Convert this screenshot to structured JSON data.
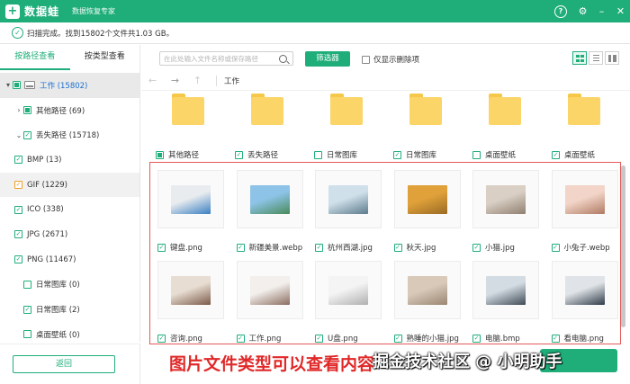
{
  "app": {
    "brand": "数据蛙",
    "subtitle": "数据恢复专家"
  },
  "window_controls": {
    "help": "?",
    "settings": "⚙",
    "minimize": "–",
    "close": "✕"
  },
  "status": {
    "text": "扫描完成。找到15802个文件共1.03 GB。"
  },
  "sidebar": {
    "tabs": [
      {
        "label": "按路径查看",
        "active": true
      },
      {
        "label": "按类型查看",
        "active": false
      }
    ],
    "tree": [
      {
        "label": "工作 (15802)",
        "level": 0,
        "arrow": "▾",
        "check": "partial",
        "drive": true
      },
      {
        "label": "其他路径 (69)",
        "level": 1,
        "arrow": "›",
        "check": "partial"
      },
      {
        "label": "丢失路径 (15718)",
        "level": 1,
        "arrow": "⌄",
        "check": "checked"
      },
      {
        "label": "BMP (13)",
        "level": 2,
        "check": "checked"
      },
      {
        "label": "GIF (1229)",
        "level": 2,
        "check": "checked",
        "highlight": true
      },
      {
        "label": "ICO (338)",
        "level": 2,
        "check": "checked"
      },
      {
        "label": "JPG (2671)",
        "level": 2,
        "check": "checked"
      },
      {
        "label": "PNG (11467)",
        "level": 2,
        "check": "checked"
      },
      {
        "label": "日常图库 (0)",
        "level": 1,
        "check": "empty"
      },
      {
        "label": "日常图库 (2)",
        "level": 1,
        "check": "checked"
      },
      {
        "label": "桌面壁纸 (0)",
        "level": 1,
        "check": "empty"
      }
    ],
    "back_label": "返回"
  },
  "toolbar": {
    "search_placeholder": "在此处输入文件名称或保存路径",
    "filter_label": "筛选器",
    "only_deleted_label": "仅显示删除项"
  },
  "path": {
    "back": "←",
    "forward": "→",
    "up": "↑",
    "current": "工作"
  },
  "folders": [
    {
      "label": "其他路径",
      "check": "partial"
    },
    {
      "label": "丢失路径",
      "check": "checked"
    },
    {
      "label": "日常图库",
      "check": "empty"
    },
    {
      "label": "日常图库",
      "check": "checked"
    },
    {
      "label": "桌面壁纸",
      "check": "empty"
    },
    {
      "label": "桌面壁纸",
      "check": "checked"
    }
  ],
  "images": [
    {
      "label": "键盘.png",
      "icon": "keyboard-image",
      "colors": [
        "#e9ecef",
        "#3a7fc1"
      ]
    },
    {
      "label": "新疆美景.webp",
      "icon": "landscape-image",
      "colors": [
        "#8cc3e6",
        "#4a8a5a"
      ]
    },
    {
      "label": "杭州西湖.jpg",
      "icon": "lake-image",
      "colors": [
        "#cfe0ea",
        "#5c7a8c"
      ]
    },
    {
      "label": "秋天.jpg",
      "icon": "autumn-image",
      "colors": [
        "#e0a13a",
        "#9a6a24"
      ]
    },
    {
      "label": "小猫.jpg",
      "icon": "cat-image",
      "colors": [
        "#d9cfc4",
        "#8f7f70"
      ]
    },
    {
      "label": "小兔子.webp",
      "icon": "rabbit-image",
      "colors": [
        "#f2d5c8",
        "#b07a62"
      ]
    },
    {
      "label": "咨询.png",
      "icon": "people-image",
      "colors": [
        "#e8ddd2",
        "#7a5a48"
      ]
    },
    {
      "label": "工作.png",
      "icon": "headset-image",
      "colors": [
        "#f2efec",
        "#8a6c5e"
      ]
    },
    {
      "label": "U盘.png",
      "icon": "usb-image",
      "colors": [
        "#f4f4f4",
        "#b0b0b0"
      ]
    },
    {
      "label": "熟睡的小猫.jpg",
      "icon": "sleeping-cat-image",
      "colors": [
        "#d8c9b9",
        "#9a8672"
      ]
    },
    {
      "label": "电脑.bmp",
      "icon": "computer-image",
      "colors": [
        "#d4dce3",
        "#3e4a55"
      ]
    },
    {
      "label": "看电脑.png",
      "icon": "looking-computer-image",
      "colors": [
        "#e0e4e8",
        "#2f3b48"
      ]
    }
  ],
  "overlay": {
    "caption": "图片文件类型可以查看内容",
    "watermark": "掘金技术社区 @ 小明助手"
  },
  "colors": {
    "accent": "#1fae7a",
    "highlight_border": "#e55a5a",
    "caption": "#e02828"
  }
}
